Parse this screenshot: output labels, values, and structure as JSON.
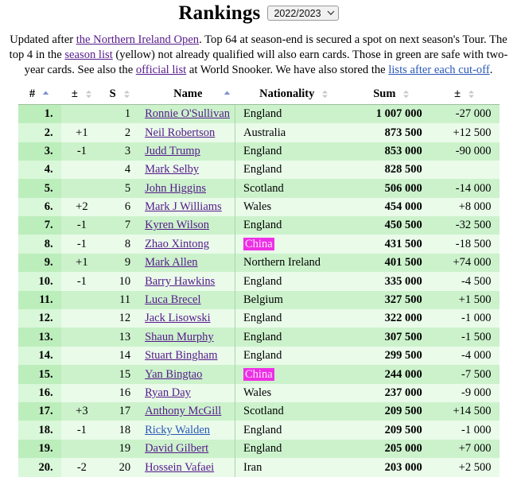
{
  "header": {
    "title": "Rankings",
    "season_select": {
      "value": "2022/2023",
      "icon": "chevron-down-icon"
    }
  },
  "intro": {
    "seg1": "Updated after ",
    "link1": "the Northern Ireland Open",
    "seg2": ". Top 64 at season-end is secured a spot on next season's Tour. The top 4 in the ",
    "link2": "season list",
    "seg3": " (yellow) not already qualified will also earn cards. Those in green are safe with two-year cards. See also the ",
    "link3": "official list",
    "seg4": " at World Snooker. We have also stored the ",
    "link4": "lists after each cut-off",
    "seg5": "."
  },
  "table": {
    "columns": [
      {
        "label": "#",
        "sort": "asc"
      },
      {
        "label": "±",
        "sort": "none"
      },
      {
        "label": "S",
        "sort": "none"
      },
      {
        "label": "Name",
        "sort": "asc"
      },
      {
        "label": "Nationality",
        "sort": "none"
      },
      {
        "label": "Sum",
        "sort": "none"
      },
      {
        "label": "±",
        "sort": "none"
      }
    ],
    "rows": [
      {
        "rank": "1.",
        "move": "",
        "s": "1",
        "name": "Ronnie O'Sullivan",
        "visited": true,
        "nat": "England",
        "nat_hl": false,
        "sum": "1 007 000",
        "diff": "-27 000"
      },
      {
        "rank": "2.",
        "move": "+1",
        "s": "2",
        "name": "Neil Robertson",
        "visited": true,
        "nat": "Australia",
        "nat_hl": false,
        "sum": "873 500",
        "diff": "+12 500"
      },
      {
        "rank": "3.",
        "move": "-1",
        "s": "3",
        "name": "Judd Trump",
        "visited": true,
        "nat": "England",
        "nat_hl": false,
        "sum": "853 000",
        "diff": "-90 000"
      },
      {
        "rank": "4.",
        "move": "",
        "s": "4",
        "name": "Mark Selby",
        "visited": true,
        "nat": "England",
        "nat_hl": false,
        "sum": "828 500",
        "diff": ""
      },
      {
        "rank": "5.",
        "move": "",
        "s": "5",
        "name": "John Higgins",
        "visited": true,
        "nat": "Scotland",
        "nat_hl": false,
        "sum": "506 000",
        "diff": "-14 000"
      },
      {
        "rank": "6.",
        "move": "+2",
        "s": "6",
        "name": "Mark J Williams",
        "visited": true,
        "nat": "Wales",
        "nat_hl": false,
        "sum": "454 000",
        "diff": "+8 000"
      },
      {
        "rank": "7.",
        "move": "-1",
        "s": "7",
        "name": "Kyren Wilson",
        "visited": true,
        "nat": "England",
        "nat_hl": false,
        "sum": "450 500",
        "diff": "-32 500"
      },
      {
        "rank": "8.",
        "move": "-1",
        "s": "8",
        "name": "Zhao Xintong",
        "visited": true,
        "nat": "China",
        "nat_hl": true,
        "sum": "431 500",
        "diff": "-18 500"
      },
      {
        "rank": "9.",
        "move": "+1",
        "s": "9",
        "name": "Mark Allen",
        "visited": true,
        "nat": "Northern Ireland",
        "nat_hl": false,
        "sum": "401 500",
        "diff": "+74 000"
      },
      {
        "rank": "10.",
        "move": "-1",
        "s": "10",
        "name": "Barry Hawkins",
        "visited": true,
        "nat": "England",
        "nat_hl": false,
        "sum": "335 000",
        "diff": "-4 500"
      },
      {
        "rank": "11.",
        "move": "",
        "s": "11",
        "name": "Luca Brecel",
        "visited": true,
        "nat": "Belgium",
        "nat_hl": false,
        "sum": "327 500",
        "diff": "+1 500"
      },
      {
        "rank": "12.",
        "move": "",
        "s": "12",
        "name": "Jack Lisowski",
        "visited": true,
        "nat": "England",
        "nat_hl": false,
        "sum": "322 000",
        "diff": "-1 000"
      },
      {
        "rank": "13.",
        "move": "",
        "s": "13",
        "name": "Shaun Murphy",
        "visited": true,
        "nat": "England",
        "nat_hl": false,
        "sum": "307 500",
        "diff": "-1 500"
      },
      {
        "rank": "14.",
        "move": "",
        "s": "14",
        "name": "Stuart Bingham",
        "visited": true,
        "nat": "England",
        "nat_hl": false,
        "sum": "299 500",
        "diff": "-4 000"
      },
      {
        "rank": "15.",
        "move": "",
        "s": "15",
        "name": "Yan Bingtao",
        "visited": true,
        "nat": "China",
        "nat_hl": true,
        "sum": "244 000",
        "diff": "-7 500"
      },
      {
        "rank": "16.",
        "move": "",
        "s": "16",
        "name": "Ryan Day",
        "visited": true,
        "nat": "Wales",
        "nat_hl": false,
        "sum": "237 000",
        "diff": "-9 000"
      },
      {
        "rank": "17.",
        "move": "+3",
        "s": "17",
        "name": "Anthony McGill",
        "visited": true,
        "nat": "Scotland",
        "nat_hl": false,
        "sum": "209 500",
        "diff": "+14 500"
      },
      {
        "rank": "18.",
        "move": "-1",
        "s": "18",
        "name": "Ricky Walden",
        "visited": false,
        "nat": "England",
        "nat_hl": false,
        "sum": "209 500",
        "diff": "-1 000"
      },
      {
        "rank": "19.",
        "move": "",
        "s": "19",
        "name": "David Gilbert",
        "visited": true,
        "nat": "England",
        "nat_hl": false,
        "sum": "205 000",
        "diff": "+7 000"
      },
      {
        "rank": "20.",
        "move": "-2",
        "s": "20",
        "name": "Hossein Vafaei",
        "visited": true,
        "nat": "Iran",
        "nat_hl": false,
        "sum": "203 000",
        "diff": "+2 500"
      }
    ]
  },
  "colors": {
    "row_odd": "#ccf2cc",
    "row_even": "#eafbea",
    "rank_odd": "#bceebc",
    "rank_even": "#d9f7d9",
    "highlight": "#ee2ee6",
    "link_visited": "#551a8b",
    "link_unvisited": "#2b58b7",
    "sort_active": "#7e8fd4"
  }
}
